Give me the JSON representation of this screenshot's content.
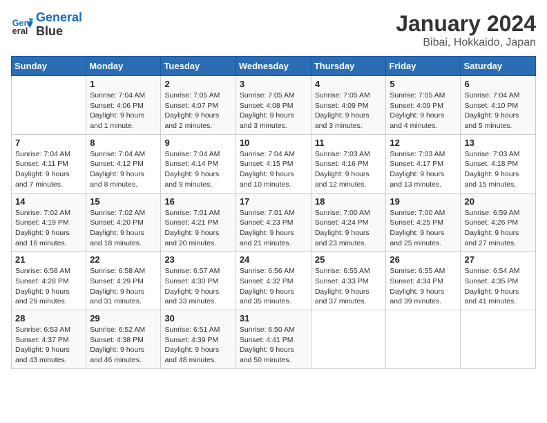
{
  "header": {
    "logo_line1": "General",
    "logo_line2": "Blue",
    "month_year": "January 2024",
    "location": "Bibai, Hokkaido, Japan"
  },
  "weekdays": [
    "Sunday",
    "Monday",
    "Tuesday",
    "Wednesday",
    "Thursday",
    "Friday",
    "Saturday"
  ],
  "weeks": [
    [
      {
        "day": "",
        "sunrise": "",
        "sunset": "",
        "daylight": ""
      },
      {
        "day": "1",
        "sunrise": "Sunrise: 7:04 AM",
        "sunset": "Sunset: 4:06 PM",
        "daylight": "Daylight: 9 hours and 1 minute."
      },
      {
        "day": "2",
        "sunrise": "Sunrise: 7:05 AM",
        "sunset": "Sunset: 4:07 PM",
        "daylight": "Daylight: 9 hours and 2 minutes."
      },
      {
        "day": "3",
        "sunrise": "Sunrise: 7:05 AM",
        "sunset": "Sunset: 4:08 PM",
        "daylight": "Daylight: 9 hours and 3 minutes."
      },
      {
        "day": "4",
        "sunrise": "Sunrise: 7:05 AM",
        "sunset": "Sunset: 4:09 PM",
        "daylight": "Daylight: 9 hours and 3 minutes."
      },
      {
        "day": "5",
        "sunrise": "Sunrise: 7:05 AM",
        "sunset": "Sunset: 4:09 PM",
        "daylight": "Daylight: 9 hours and 4 minutes."
      },
      {
        "day": "6",
        "sunrise": "Sunrise: 7:04 AM",
        "sunset": "Sunset: 4:10 PM",
        "daylight": "Daylight: 9 hours and 5 minutes."
      }
    ],
    [
      {
        "day": "7",
        "sunrise": "Sunrise: 7:04 AM",
        "sunset": "Sunset: 4:11 PM",
        "daylight": "Daylight: 9 hours and 7 minutes."
      },
      {
        "day": "8",
        "sunrise": "Sunrise: 7:04 AM",
        "sunset": "Sunset: 4:12 PM",
        "daylight": "Daylight: 9 hours and 8 minutes."
      },
      {
        "day": "9",
        "sunrise": "Sunrise: 7:04 AM",
        "sunset": "Sunset: 4:14 PM",
        "daylight": "Daylight: 9 hours and 9 minutes."
      },
      {
        "day": "10",
        "sunrise": "Sunrise: 7:04 AM",
        "sunset": "Sunset: 4:15 PM",
        "daylight": "Daylight: 9 hours and 10 minutes."
      },
      {
        "day": "11",
        "sunrise": "Sunrise: 7:03 AM",
        "sunset": "Sunset: 4:16 PM",
        "daylight": "Daylight: 9 hours and 12 minutes."
      },
      {
        "day": "12",
        "sunrise": "Sunrise: 7:03 AM",
        "sunset": "Sunset: 4:17 PM",
        "daylight": "Daylight: 9 hours and 13 minutes."
      },
      {
        "day": "13",
        "sunrise": "Sunrise: 7:03 AM",
        "sunset": "Sunset: 4:18 PM",
        "daylight": "Daylight: 9 hours and 15 minutes."
      }
    ],
    [
      {
        "day": "14",
        "sunrise": "Sunrise: 7:02 AM",
        "sunset": "Sunset: 4:19 PM",
        "daylight": "Daylight: 9 hours and 16 minutes."
      },
      {
        "day": "15",
        "sunrise": "Sunrise: 7:02 AM",
        "sunset": "Sunset: 4:20 PM",
        "daylight": "Daylight: 9 hours and 18 minutes."
      },
      {
        "day": "16",
        "sunrise": "Sunrise: 7:01 AM",
        "sunset": "Sunset: 4:21 PM",
        "daylight": "Daylight: 9 hours and 20 minutes."
      },
      {
        "day": "17",
        "sunrise": "Sunrise: 7:01 AM",
        "sunset": "Sunset: 4:23 PM",
        "daylight": "Daylight: 9 hours and 21 minutes."
      },
      {
        "day": "18",
        "sunrise": "Sunrise: 7:00 AM",
        "sunset": "Sunset: 4:24 PM",
        "daylight": "Daylight: 9 hours and 23 minutes."
      },
      {
        "day": "19",
        "sunrise": "Sunrise: 7:00 AM",
        "sunset": "Sunset: 4:25 PM",
        "daylight": "Daylight: 9 hours and 25 minutes."
      },
      {
        "day": "20",
        "sunrise": "Sunrise: 6:59 AM",
        "sunset": "Sunset: 4:26 PM",
        "daylight": "Daylight: 9 hours and 27 minutes."
      }
    ],
    [
      {
        "day": "21",
        "sunrise": "Sunrise: 6:58 AM",
        "sunset": "Sunset: 4:28 PM",
        "daylight": "Daylight: 9 hours and 29 minutes."
      },
      {
        "day": "22",
        "sunrise": "Sunrise: 6:58 AM",
        "sunset": "Sunset: 4:29 PM",
        "daylight": "Daylight: 9 hours and 31 minutes."
      },
      {
        "day": "23",
        "sunrise": "Sunrise: 6:57 AM",
        "sunset": "Sunset: 4:30 PM",
        "daylight": "Daylight: 9 hours and 33 minutes."
      },
      {
        "day": "24",
        "sunrise": "Sunrise: 6:56 AM",
        "sunset": "Sunset: 4:32 PM",
        "daylight": "Daylight: 9 hours and 35 minutes."
      },
      {
        "day": "25",
        "sunrise": "Sunrise: 6:55 AM",
        "sunset": "Sunset: 4:33 PM",
        "daylight": "Daylight: 9 hours and 37 minutes."
      },
      {
        "day": "26",
        "sunrise": "Sunrise: 6:55 AM",
        "sunset": "Sunset: 4:34 PM",
        "daylight": "Daylight: 9 hours and 39 minutes."
      },
      {
        "day": "27",
        "sunrise": "Sunrise: 6:54 AM",
        "sunset": "Sunset: 4:35 PM",
        "daylight": "Daylight: 9 hours and 41 minutes."
      }
    ],
    [
      {
        "day": "28",
        "sunrise": "Sunrise: 6:53 AM",
        "sunset": "Sunset: 4:37 PM",
        "daylight": "Daylight: 9 hours and 43 minutes."
      },
      {
        "day": "29",
        "sunrise": "Sunrise: 6:52 AM",
        "sunset": "Sunset: 4:38 PM",
        "daylight": "Daylight: 9 hours and 46 minutes."
      },
      {
        "day": "30",
        "sunrise": "Sunrise: 6:51 AM",
        "sunset": "Sunset: 4:39 PM",
        "daylight": "Daylight: 9 hours and 48 minutes."
      },
      {
        "day": "31",
        "sunrise": "Sunrise: 6:50 AM",
        "sunset": "Sunset: 4:41 PM",
        "daylight": "Daylight: 9 hours and 50 minutes."
      },
      {
        "day": "",
        "sunrise": "",
        "sunset": "",
        "daylight": ""
      },
      {
        "day": "",
        "sunrise": "",
        "sunset": "",
        "daylight": ""
      },
      {
        "day": "",
        "sunrise": "",
        "sunset": "",
        "daylight": ""
      }
    ]
  ]
}
